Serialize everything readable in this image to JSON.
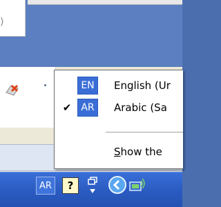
{
  "background": {
    "top_window_glyph": ")"
  },
  "menu": {
    "items": [
      {
        "badge": "EN",
        "label": "English (Ur",
        "checked": false
      },
      {
        "badge": "AR",
        "label": "Arabic (Sa",
        "checked": true
      }
    ],
    "show_label_underlined": "S",
    "show_label_rest": "how the",
    "check_mark": "✔"
  },
  "taskbar": {
    "language_indicator": "AR",
    "help_icon": "?",
    "icons": [
      "language-indicator-icon",
      "help-icon",
      "restore-icon",
      "back-arrow-icon",
      "network-icon"
    ]
  },
  "colors": {
    "badge_blue": "#3a6ed6",
    "taskbar_blue": "#2b5cc2",
    "menu_bg": "#ffffff"
  }
}
